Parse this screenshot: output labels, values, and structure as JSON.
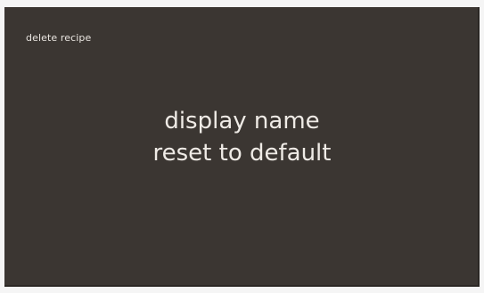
{
  "header": {
    "delete_recipe_label": "delete recipe"
  },
  "menu": {
    "items": [
      {
        "label": "display name"
      },
      {
        "label": "reset to default"
      }
    ]
  },
  "colors": {
    "background": "#3b3632",
    "text": "#efebe6"
  }
}
